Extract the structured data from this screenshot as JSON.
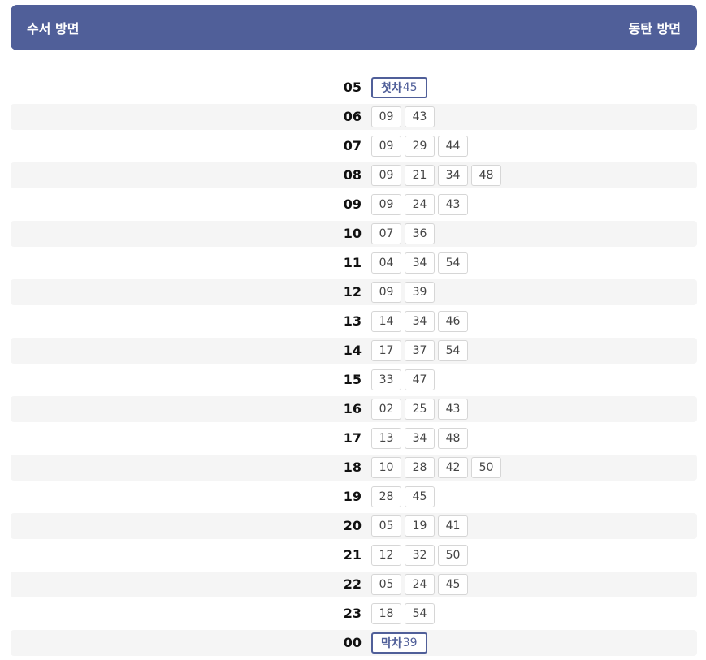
{
  "header": {
    "left": "수서 방면",
    "right": "동탄 방면"
  },
  "schedule": [
    {
      "hour": "05",
      "mins": [
        {
          "tag": "첫차",
          "min": "45"
        }
      ]
    },
    {
      "hour": "06",
      "mins": [
        {
          "min": "09"
        },
        {
          "min": "43"
        }
      ]
    },
    {
      "hour": "07",
      "mins": [
        {
          "min": "09"
        },
        {
          "min": "29"
        },
        {
          "min": "44"
        }
      ]
    },
    {
      "hour": "08",
      "mins": [
        {
          "min": "09"
        },
        {
          "min": "21"
        },
        {
          "min": "34"
        },
        {
          "min": "48"
        }
      ]
    },
    {
      "hour": "09",
      "mins": [
        {
          "min": "09"
        },
        {
          "min": "24"
        },
        {
          "min": "43"
        }
      ]
    },
    {
      "hour": "10",
      "mins": [
        {
          "min": "07"
        },
        {
          "min": "36"
        }
      ]
    },
    {
      "hour": "11",
      "mins": [
        {
          "min": "04"
        },
        {
          "min": "34"
        },
        {
          "min": "54"
        }
      ]
    },
    {
      "hour": "12",
      "mins": [
        {
          "min": "09"
        },
        {
          "min": "39"
        }
      ]
    },
    {
      "hour": "13",
      "mins": [
        {
          "min": "14"
        },
        {
          "min": "34"
        },
        {
          "min": "46"
        }
      ]
    },
    {
      "hour": "14",
      "mins": [
        {
          "min": "17"
        },
        {
          "min": "37"
        },
        {
          "min": "54"
        }
      ]
    },
    {
      "hour": "15",
      "mins": [
        {
          "min": "33"
        },
        {
          "min": "47"
        }
      ]
    },
    {
      "hour": "16",
      "mins": [
        {
          "min": "02"
        },
        {
          "min": "25"
        },
        {
          "min": "43"
        }
      ]
    },
    {
      "hour": "17",
      "mins": [
        {
          "min": "13"
        },
        {
          "min": "34"
        },
        {
          "min": "48"
        }
      ]
    },
    {
      "hour": "18",
      "mins": [
        {
          "min": "10"
        },
        {
          "min": "28"
        },
        {
          "min": "42"
        },
        {
          "min": "50"
        }
      ]
    },
    {
      "hour": "19",
      "mins": [
        {
          "min": "28"
        },
        {
          "min": "45"
        }
      ]
    },
    {
      "hour": "20",
      "mins": [
        {
          "min": "05"
        },
        {
          "min": "19"
        },
        {
          "min": "41"
        }
      ]
    },
    {
      "hour": "21",
      "mins": [
        {
          "min": "12"
        },
        {
          "min": "32"
        },
        {
          "min": "50"
        }
      ]
    },
    {
      "hour": "22",
      "mins": [
        {
          "min": "05"
        },
        {
          "min": "24"
        },
        {
          "min": "45"
        }
      ]
    },
    {
      "hour": "23",
      "mins": [
        {
          "min": "18"
        },
        {
          "min": "54"
        }
      ]
    },
    {
      "hour": "00",
      "mins": [
        {
          "tag": "막차",
          "min": "39"
        }
      ]
    }
  ]
}
